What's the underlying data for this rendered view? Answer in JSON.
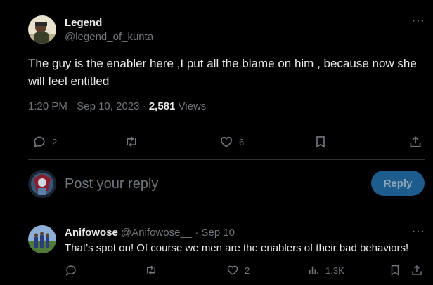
{
  "tweet": {
    "author_name": "Legend",
    "author_handle": "@legend_of_kunta",
    "text": "The guy is the enabler here ,I put all the blame on him , because now she will feel entitled",
    "time": "1:20 PM",
    "date": "Sep 10, 2023",
    "views_count": "2,581",
    "views_label": "Views",
    "more_label": "···",
    "actions": {
      "replies": "2",
      "reposts": "",
      "likes": "6"
    }
  },
  "composer": {
    "placeholder": "Post your reply",
    "button_label": "Reply"
  },
  "reply": {
    "author_name": "Anifowose",
    "author_handle": "@Anifowose__",
    "date": "Sep 10",
    "text": "That’s spot on! Of course we men are the enablers of their bad behaviors!",
    "more_label": "···",
    "actions": {
      "replies": "",
      "reposts": "",
      "likes": "2",
      "views": "1.3K"
    }
  },
  "colors": {
    "background": "#000000",
    "text": "#e7e9ea",
    "muted": "#71767b",
    "divider": "#2f3336",
    "reply_button_bg": "#1d5c8d"
  },
  "icons": [
    "reply-icon",
    "repost-icon",
    "like-icon",
    "bookmark-icon",
    "share-icon",
    "views-icon",
    "more-icon"
  ]
}
